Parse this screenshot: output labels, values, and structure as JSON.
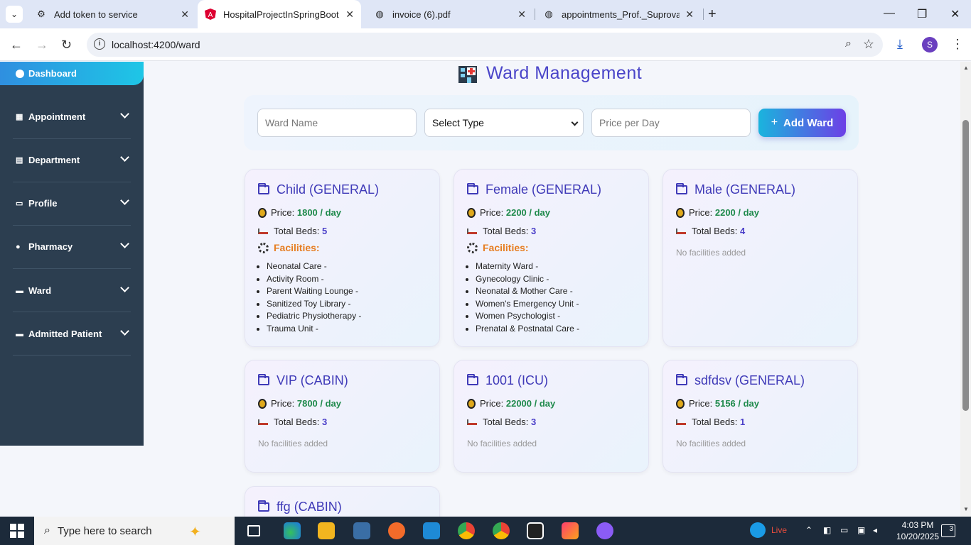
{
  "browser": {
    "tabs": [
      {
        "title": "Add token to service",
        "active": false
      },
      {
        "title": "HospitalProjectInSpringBoot",
        "active": true
      },
      {
        "title": "invoice (6).pdf",
        "active": false
      },
      {
        "title": "appointments_Prof._Suprova_Si",
        "active": false
      }
    ],
    "url": "localhost:4200/ward",
    "profile_initial": "S"
  },
  "sidebar": {
    "dashboard_label": "Dashboard",
    "items": [
      {
        "label": "Appointment",
        "icon": "calendar-icon"
      },
      {
        "label": "Department",
        "icon": "building-icon"
      },
      {
        "label": "Profile",
        "icon": "id-card-icon"
      },
      {
        "label": "Pharmacy",
        "icon": "pills-icon"
      },
      {
        "label": "Ward",
        "icon": "bed-icon"
      },
      {
        "label": "Admitted Patient",
        "icon": "bed-icon"
      }
    ]
  },
  "main": {
    "title": "Ward Management",
    "form": {
      "ward_name_placeholder": "Ward Name",
      "type_selected": "Select Type",
      "price_placeholder": "Price per Day",
      "add_button": "Add Ward"
    },
    "labels": {
      "price": "Price:",
      "beds": "Total Beds:",
      "facilities": "Facilities:",
      "no_facilities": "No facilities added",
      "per_day": " / day"
    },
    "wards": [
      {
        "name": "Child (GENERAL)",
        "price": "1800 / day",
        "beds": "5",
        "facilities": [
          "Neonatal Care -",
          "Activity Room -",
          "Parent Waiting Lounge -",
          "Sanitized Toy Library -",
          "Pediatric Physiotherapy -",
          "Trauma Unit -"
        ]
      },
      {
        "name": "Female (GENERAL)",
        "price": "2200 / day",
        "beds": "3",
        "facilities": [
          "Maternity Ward -",
          "Gynecology Clinic -",
          "Neonatal & Mother Care -",
          "Women's Emergency Unit -",
          "Women Psychologist -",
          "Prenatal & Postnatal Care -"
        ]
      },
      {
        "name": "Male (GENERAL)",
        "price": "2200 / day",
        "beds": "4",
        "facilities": []
      },
      {
        "name": "VIP (CABIN)",
        "price": "7800 / day",
        "beds": "3",
        "facilities": []
      },
      {
        "name": "1001 (ICU)",
        "price": "22000 / day",
        "beds": "3",
        "facilities": []
      },
      {
        "name": "sdfdsv (GENERAL)",
        "price": "5156 / day",
        "beds": "1",
        "facilities": []
      },
      {
        "name": "ffg (CABIN)",
        "price": "",
        "beds": "",
        "facilities": []
      }
    ]
  },
  "taskbar": {
    "search_placeholder": "Type here to search",
    "weather_label": "Live",
    "time": "4:03 PM",
    "date": "10/20/2025",
    "notification_count": "3"
  }
}
